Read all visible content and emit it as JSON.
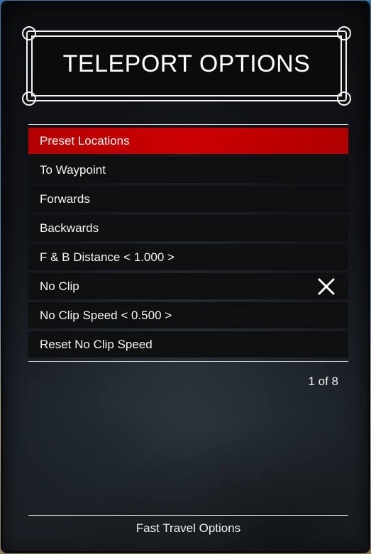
{
  "title": "TELEPORT OPTIONS",
  "menu": {
    "items": [
      {
        "label": "Preset Locations",
        "selected": true
      },
      {
        "label": "To Waypoint"
      },
      {
        "label": "Forwards"
      },
      {
        "label": "Backwards"
      },
      {
        "label": "F & B Distance < 1.000 >"
      },
      {
        "label": "No Clip",
        "toggle": "off",
        "toggle_icon": "x-icon"
      },
      {
        "label": "No Clip Speed < 0.500 >"
      },
      {
        "label": "Reset No Clip Speed"
      }
    ]
  },
  "page_counter": "1 of 8",
  "footer": {
    "description": "Fast Travel Options"
  },
  "colors": {
    "selected": "#cc0000",
    "background": "#0e0f11",
    "text": "#ffffff"
  }
}
